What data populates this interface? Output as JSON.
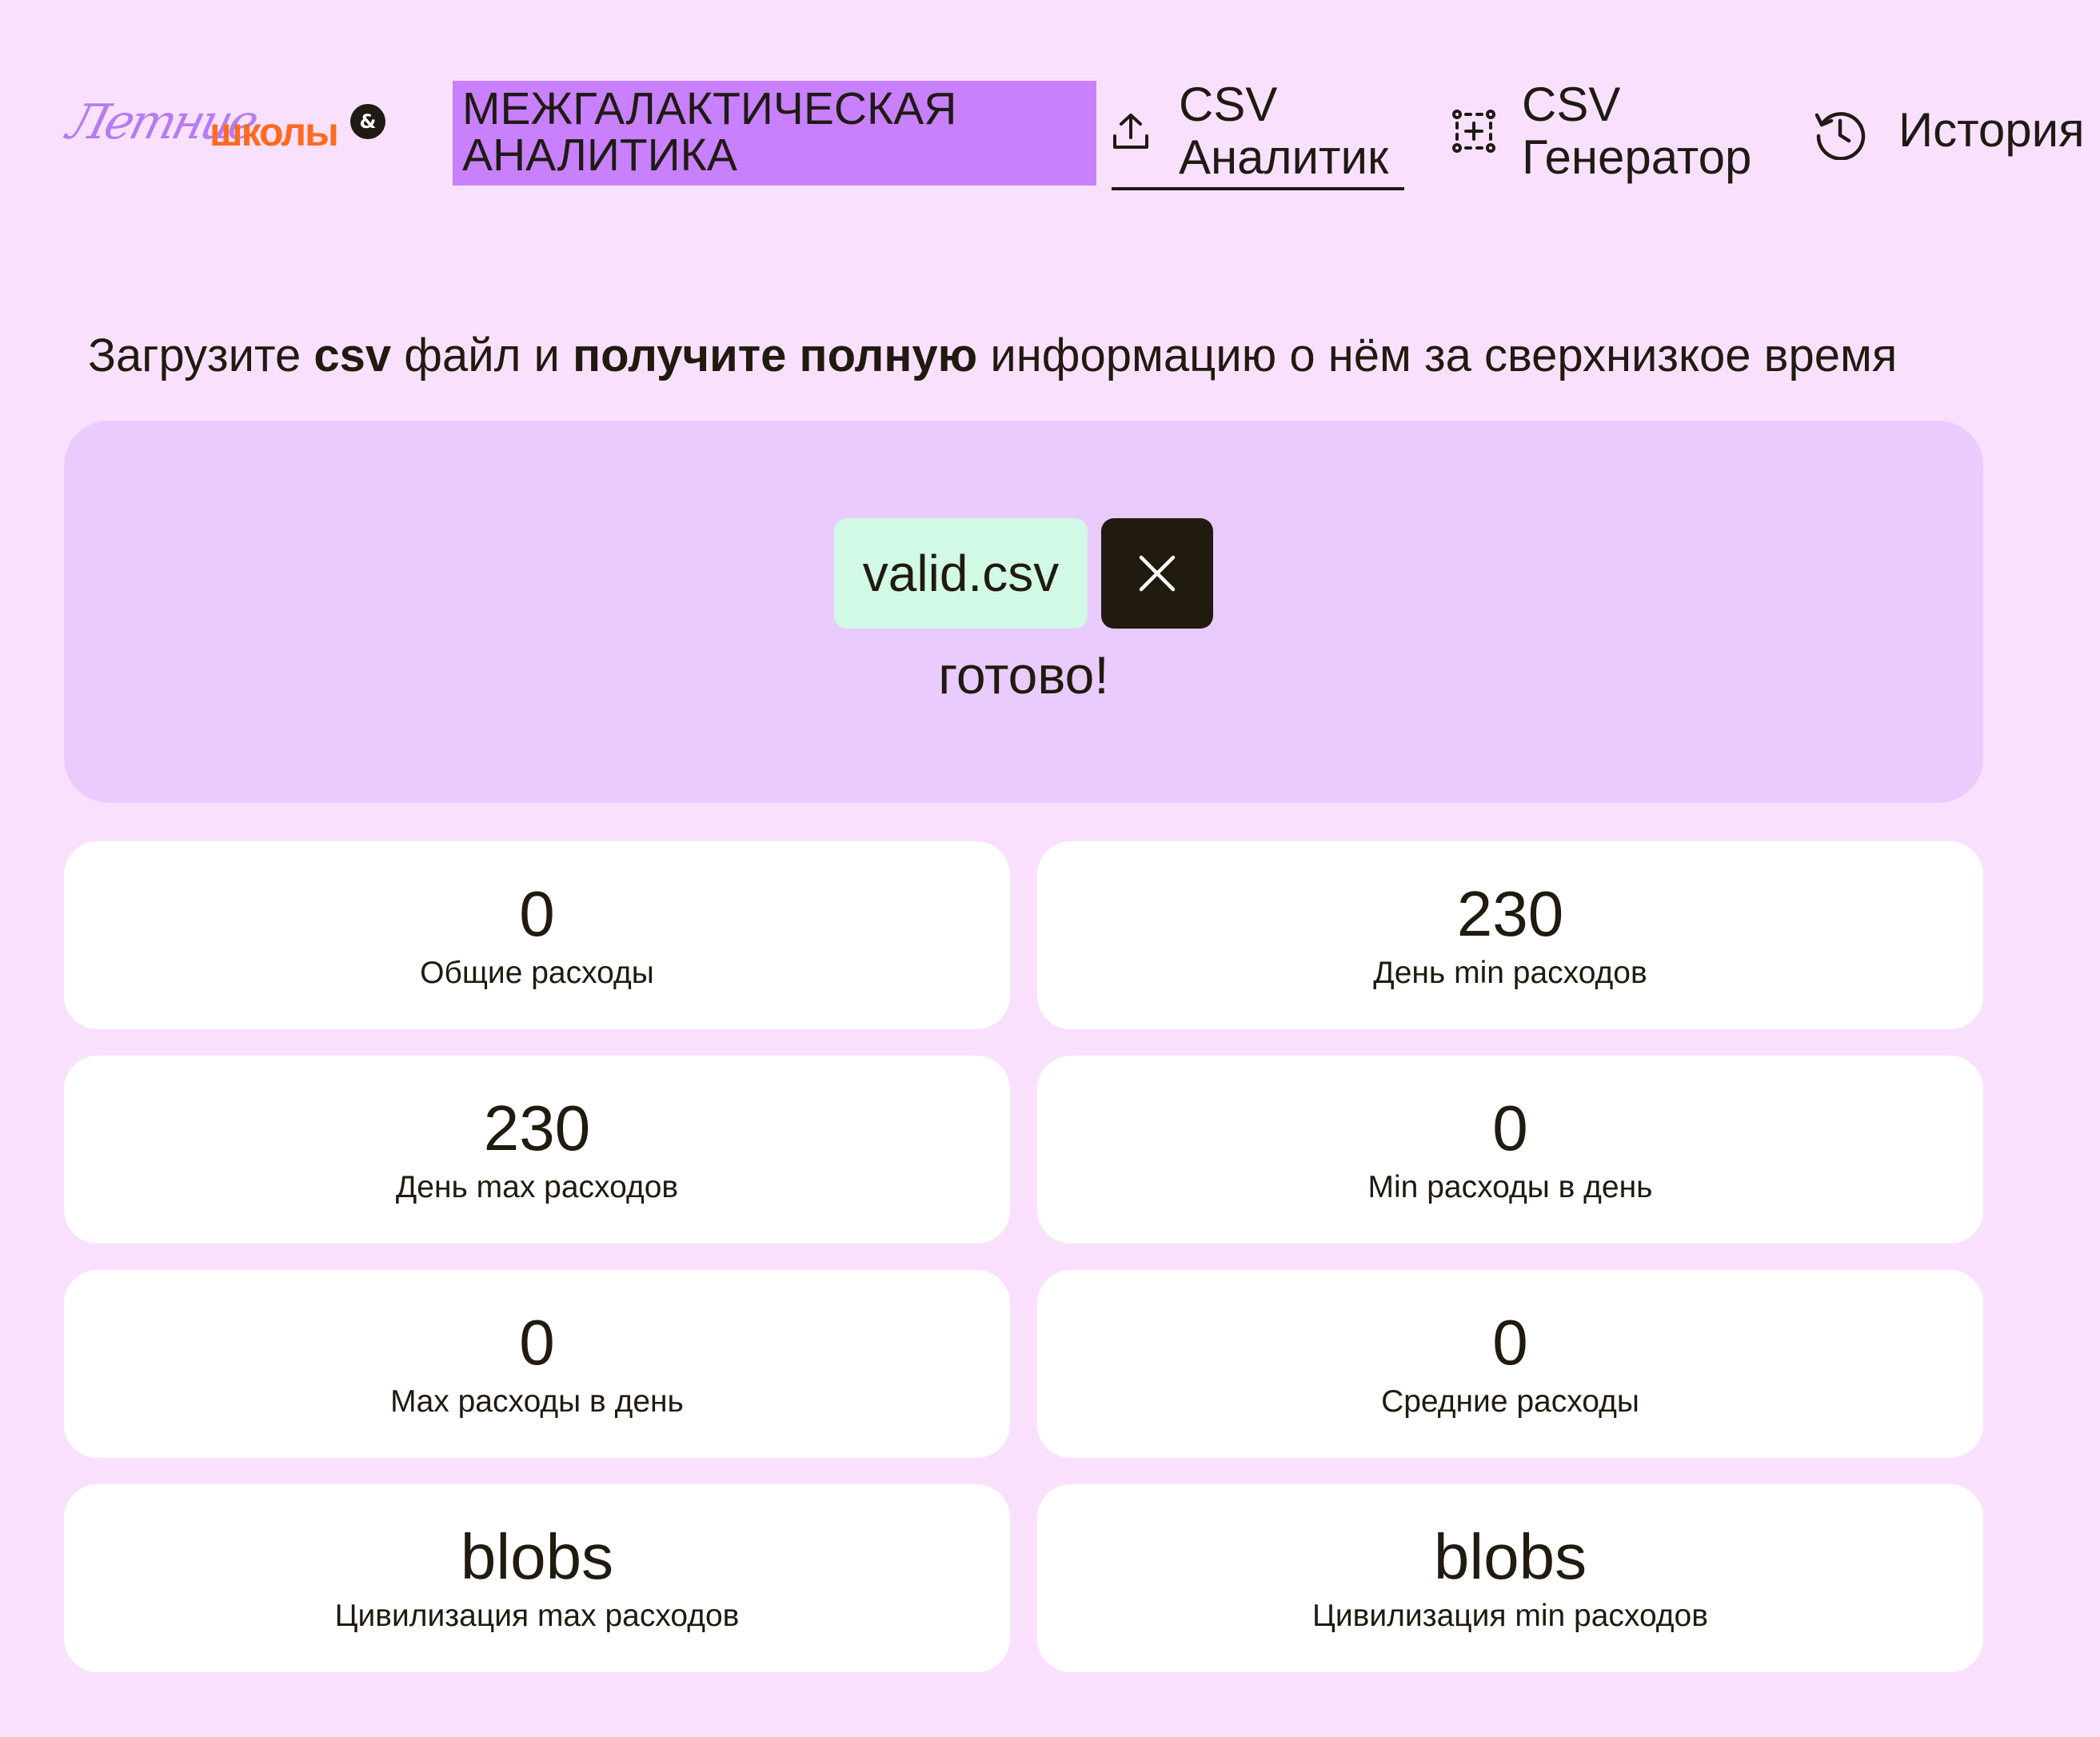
{
  "header": {
    "logo": {
      "script_text": "Летние",
      "bold_text": "школы",
      "badge": "&"
    },
    "brand": {
      "line1": "МЕЖГАЛАКТИЧЕСКАЯ",
      "line2": "АНАЛИТИКА"
    },
    "nav": {
      "analyzer": {
        "line1": "CSV",
        "line2": "Аналитик",
        "icon": "upload-icon",
        "active": true
      },
      "generator": {
        "line1": "CSV",
        "line2": "Генератор",
        "icon": "generate-icon"
      },
      "history": {
        "label": "История",
        "icon": "history-clock-icon"
      }
    }
  },
  "tagline": {
    "part1": "Загрузите ",
    "bold1": "csv",
    "part2": " файл и ",
    "bold2": "получите полную",
    "part3": " информацию о нём за сверхнизкое время"
  },
  "upload": {
    "file_name": "valid.csv",
    "remove_icon": "close-icon",
    "status": "готово!"
  },
  "stats": [
    {
      "value": "0",
      "label": "Общие расходы"
    },
    {
      "value": "230",
      "label": "День min расходов"
    },
    {
      "value": "230",
      "label": "День max расходов"
    },
    {
      "value": "0",
      "label": "Min расходы в день"
    },
    {
      "value": "0",
      "label": "Max расходы в день"
    },
    {
      "value": "0",
      "label": "Средние расходы"
    },
    {
      "value": "blobs",
      "label": "Цивилизация max расходов"
    },
    {
      "value": "blobs",
      "label": "Цивилизация min расходов"
    }
  ],
  "colors": {
    "background": "#f9e1fe",
    "brand_highlight": "#c880fc",
    "upload_area": "#e9cbfd",
    "file_chip": "#d2f8e6",
    "dark": "#201a0f",
    "card": "#ffffff",
    "logo_orange": "#ff6a1f",
    "logo_purple": "#b47cf0"
  }
}
